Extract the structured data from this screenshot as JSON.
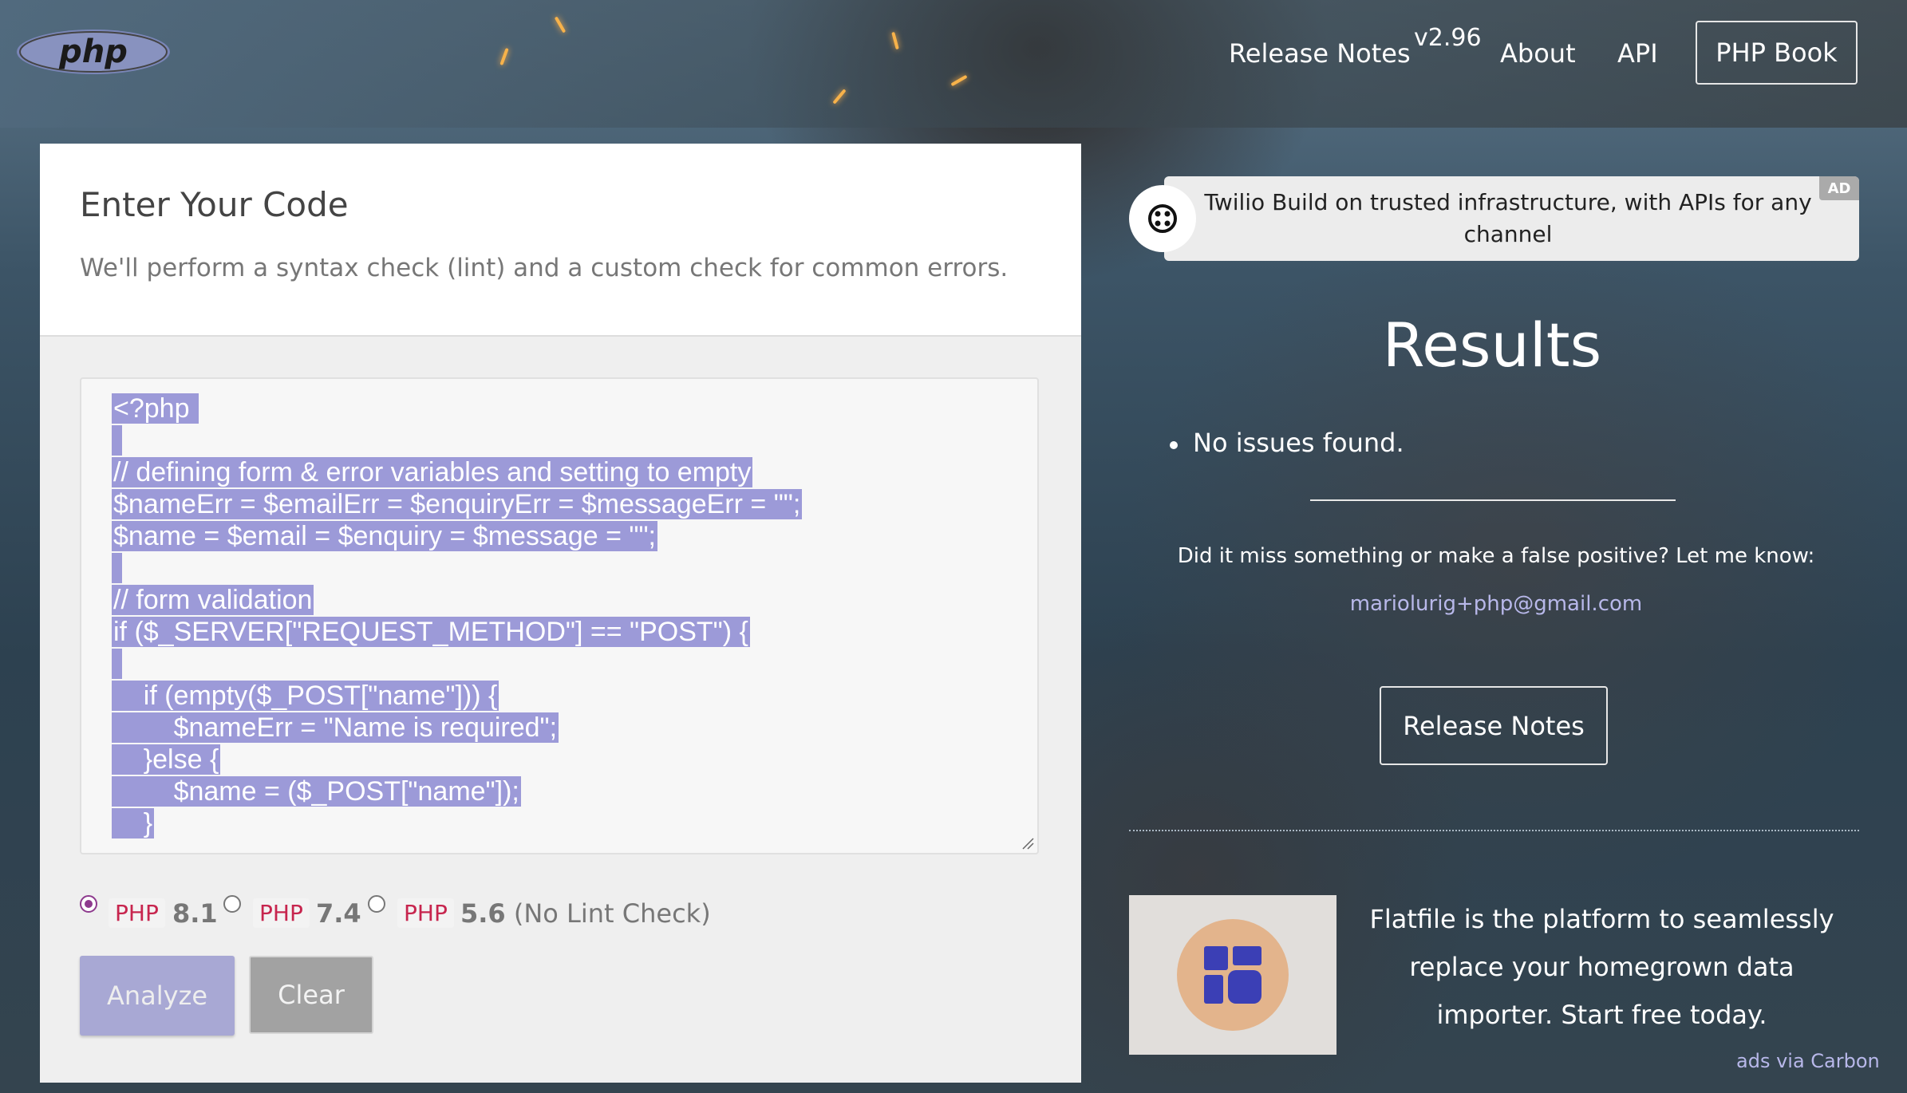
{
  "header": {
    "logo_text": "php",
    "nav": {
      "release_notes": "Release Notes",
      "version": "v2.96",
      "about": "About",
      "api": "API",
      "php_book": "PHP Book"
    }
  },
  "editor_panel": {
    "title": "Enter Your Code",
    "subtitle": "We'll perform a syntax check (lint) and a custom check for common errors.",
    "code_lines": [
      "<?php ",
      " ",
      "// defining form & error variables and setting to empty",
      "$nameErr = $emailErr = $enquiryErr = $messageErr = \"\";",
      "$name = $email = $enquiry = $message = \"\";",
      " ",
      "// form validation",
      "if ($_SERVER[\"REQUEST_METHOD\"] == \"POST\") {",
      " ",
      "    if (empty($_POST[\"name\"])) {",
      "        $nameErr = \"Name is required\";",
      "    }else {",
      "        $name = ($_POST[\"name\"]);",
      "    }"
    ],
    "versions": [
      {
        "tag": "PHP",
        "number": "8.1",
        "note": "",
        "selected": true
      },
      {
        "tag": "PHP",
        "number": "7.4",
        "note": "",
        "selected": false
      },
      {
        "tag": "PHP",
        "number": "5.6",
        "note": " (No Lint Check)",
        "selected": false
      }
    ],
    "analyze_label": "Analyze",
    "clear_label": "Clear"
  },
  "ad_top": {
    "text": "Twilio Build on trusted infrastructure, with APIs for any channel",
    "badge": "AD"
  },
  "results": {
    "title": "Results",
    "items": [
      "No issues found."
    ],
    "feedback_text": "Did it miss something or make a false positive? Let me know:",
    "email": "mariolurig+php@gmail.com",
    "release_notes_label": "Release Notes"
  },
  "carbon_ad": {
    "text": "Flatfile is the platform to seamlessly replace your homegrown data importer. Start free today.",
    "via": "ads via Carbon"
  },
  "colors": {
    "accent_purple": "#8e3a8e",
    "selection": "#9c9ad8",
    "php_tag": "#c7254e",
    "link": "#b8b8ea"
  }
}
